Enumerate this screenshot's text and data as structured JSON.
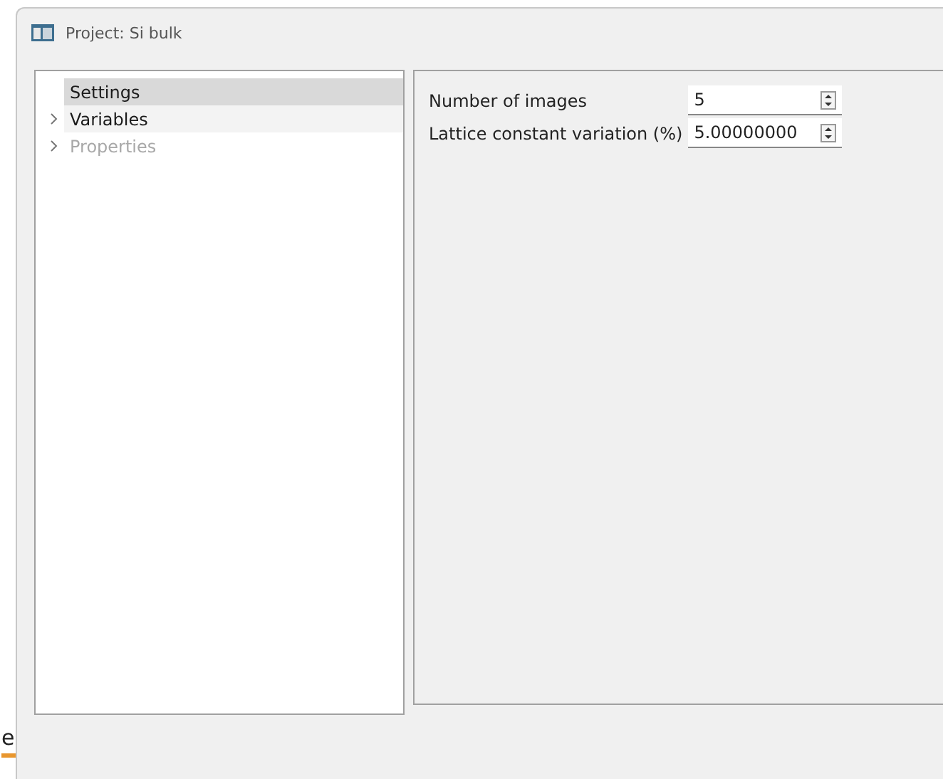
{
  "background_text": "e",
  "window": {
    "title": "Project: Si bulk"
  },
  "tree": {
    "items": [
      {
        "label": "Settings",
        "expandable": false,
        "selected": true,
        "hovered": false,
        "disabled": false
      },
      {
        "label": "Variables",
        "expandable": true,
        "selected": false,
        "hovered": true,
        "disabled": false
      },
      {
        "label": "Properties",
        "expandable": true,
        "selected": false,
        "hovered": false,
        "disabled": true
      }
    ]
  },
  "settings": {
    "fields": [
      {
        "label": "Number of images",
        "value": "5"
      },
      {
        "label": "Lattice constant variation (%)",
        "value": "5.00000000"
      }
    ]
  }
}
